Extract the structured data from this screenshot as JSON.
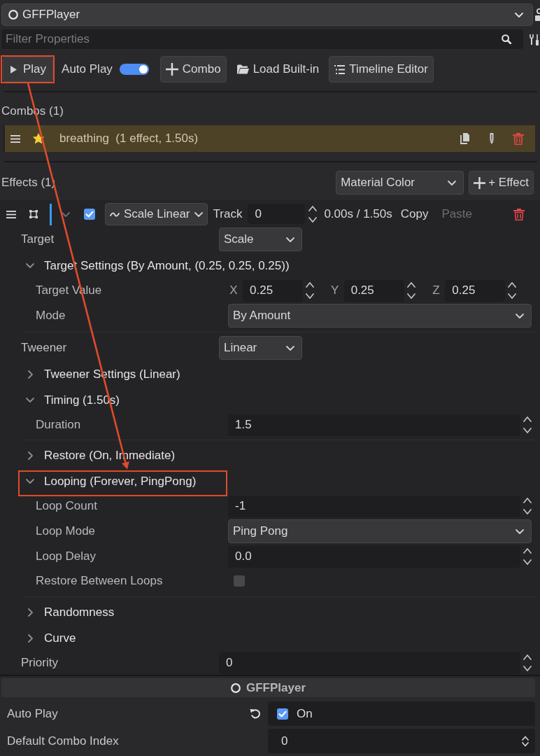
{
  "node_selector": {
    "value": "GFFPlayer"
  },
  "filter": {
    "placeholder": "Filter Properties"
  },
  "toolbar": {
    "play": {
      "label": "Play",
      "highlighted": true
    },
    "auto_play": {
      "label": "Auto Play",
      "on": true
    },
    "buttons": [
      {
        "kind": "add",
        "label": "Combo",
        "flat": false
      },
      {
        "kind": "folder",
        "label": "Load Built-in",
        "flat": true
      },
      {
        "kind": "list",
        "label": "Timeline Editor",
        "flat": false
      }
    ]
  },
  "combos": {
    "title": "Combos (1)",
    "items": [
      {
        "label": "breathing  (1 effect, 1.50s)",
        "starred": true,
        "selected": true
      }
    ]
  },
  "effects": {
    "title": "Effects (1)",
    "type_picker": "Material Color",
    "add_button": "+ Effect",
    "items": [
      {
        "enabled": true,
        "color": "#3a9cf0",
        "type": "Scale Linear",
        "track_label": "Track",
        "track": "0",
        "time": "0.00s / 1.50s",
        "actions": [
          {
            "label": "Copy",
            "disabled": false
          },
          {
            "label": "Paste",
            "disabled": true
          }
        ],
        "properties": [
          {
            "kind": "dropdown",
            "label": "Target",
            "value": "Scale"
          },
          {
            "kind": "section",
            "label": "Target Settings (By Amount, (0.25, 0.25, 0.25))",
            "expanded": true,
            "highlighted": false,
            "children": [
              {
                "kind": "vector3",
                "label": "Target Value",
                "fields": [
                  {
                    "axis": "X",
                    "value": "0.25"
                  },
                  {
                    "axis": "Y",
                    "value": "0.25"
                  },
                  {
                    "axis": "Z",
                    "value": "0.25"
                  }
                ]
              },
              {
                "kind": "dropdown",
                "label": "Mode",
                "value": "By Amount"
              }
            ]
          },
          {
            "kind": "dropdown",
            "label": "Tweener",
            "value": "Linear"
          },
          {
            "kind": "section",
            "label": "Tweener Settings (Linear)",
            "expanded": false,
            "highlighted": false
          },
          {
            "kind": "section",
            "label": "Timing (1.50s)",
            "expanded": true,
            "highlighted": false,
            "children": [
              {
                "kind": "spin",
                "label": "Duration",
                "value": "1.5"
              }
            ]
          },
          {
            "kind": "section",
            "label": "Restore (On, Immediate)",
            "expanded": false,
            "highlighted": false
          },
          {
            "kind": "section",
            "label": "Looping (Forever, PingPong)",
            "expanded": true,
            "highlighted": true,
            "children": [
              {
                "kind": "spin",
                "label": "Loop Count",
                "value": "-1"
              },
              {
                "kind": "dropdown",
                "label": "Loop Mode",
                "value": "Ping Pong"
              },
              {
                "kind": "spin",
                "label": "Loop Delay",
                "value": "0.0"
              },
              {
                "kind": "checkbox",
                "label": "Restore Between Loops",
                "checked": false
              }
            ]
          },
          {
            "kind": "section",
            "label": "Randomness",
            "expanded": false,
            "highlighted": false
          },
          {
            "kind": "section",
            "label": "Curve",
            "expanded": false,
            "highlighted": false
          },
          {
            "kind": "spin",
            "label": "Priority",
            "value": "0"
          }
        ]
      }
    ]
  },
  "component": {
    "title": "GFFPlayer",
    "properties": [
      {
        "kind": "checkbox",
        "label": "Auto Play",
        "checked": true,
        "text": "On",
        "revertable": true
      },
      {
        "kind": "spin",
        "label": "Default Combo Index",
        "value": "0",
        "revertable": false
      }
    ]
  },
  "annotations": {
    "arrow": true
  }
}
